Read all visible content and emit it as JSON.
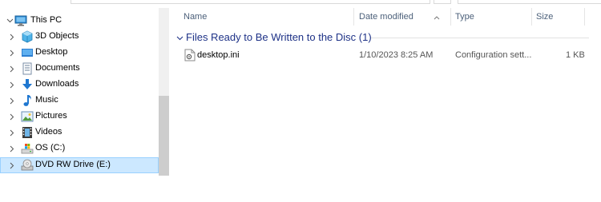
{
  "nav": {
    "items": [
      {
        "label": "This PC",
        "icon": "computer-icon",
        "expanded": true
      },
      {
        "label": "3D Objects",
        "icon": "3d-objects-icon"
      },
      {
        "label": "Desktop",
        "icon": "desktop-folder-icon"
      },
      {
        "label": "Documents",
        "icon": "documents-icon"
      },
      {
        "label": "Downloads",
        "icon": "downloads-icon"
      },
      {
        "label": "Music",
        "icon": "music-icon"
      },
      {
        "label": "Pictures",
        "icon": "pictures-icon"
      },
      {
        "label": "Videos",
        "icon": "videos-icon"
      },
      {
        "label": "OS (C:)",
        "icon": "drive-icon"
      },
      {
        "label": "DVD RW Drive (E:)",
        "icon": "dvd-drive-icon",
        "selected": true
      }
    ]
  },
  "columns": {
    "name": "Name",
    "date": "Date modified",
    "type": "Type",
    "size": "Size"
  },
  "group": {
    "label": "Files Ready to Be Written to the Disc (1)"
  },
  "files": [
    {
      "name": "desktop.ini",
      "date": "1/10/2023 8:25 AM",
      "type": "Configuration sett...",
      "size": "1 KB",
      "icon": "settings-file-icon"
    }
  ],
  "colors": {
    "selection_bg": "#cce8ff",
    "selection_border": "#99d1ff",
    "group_header": "#1e3287",
    "column_header": "#4c607a"
  }
}
